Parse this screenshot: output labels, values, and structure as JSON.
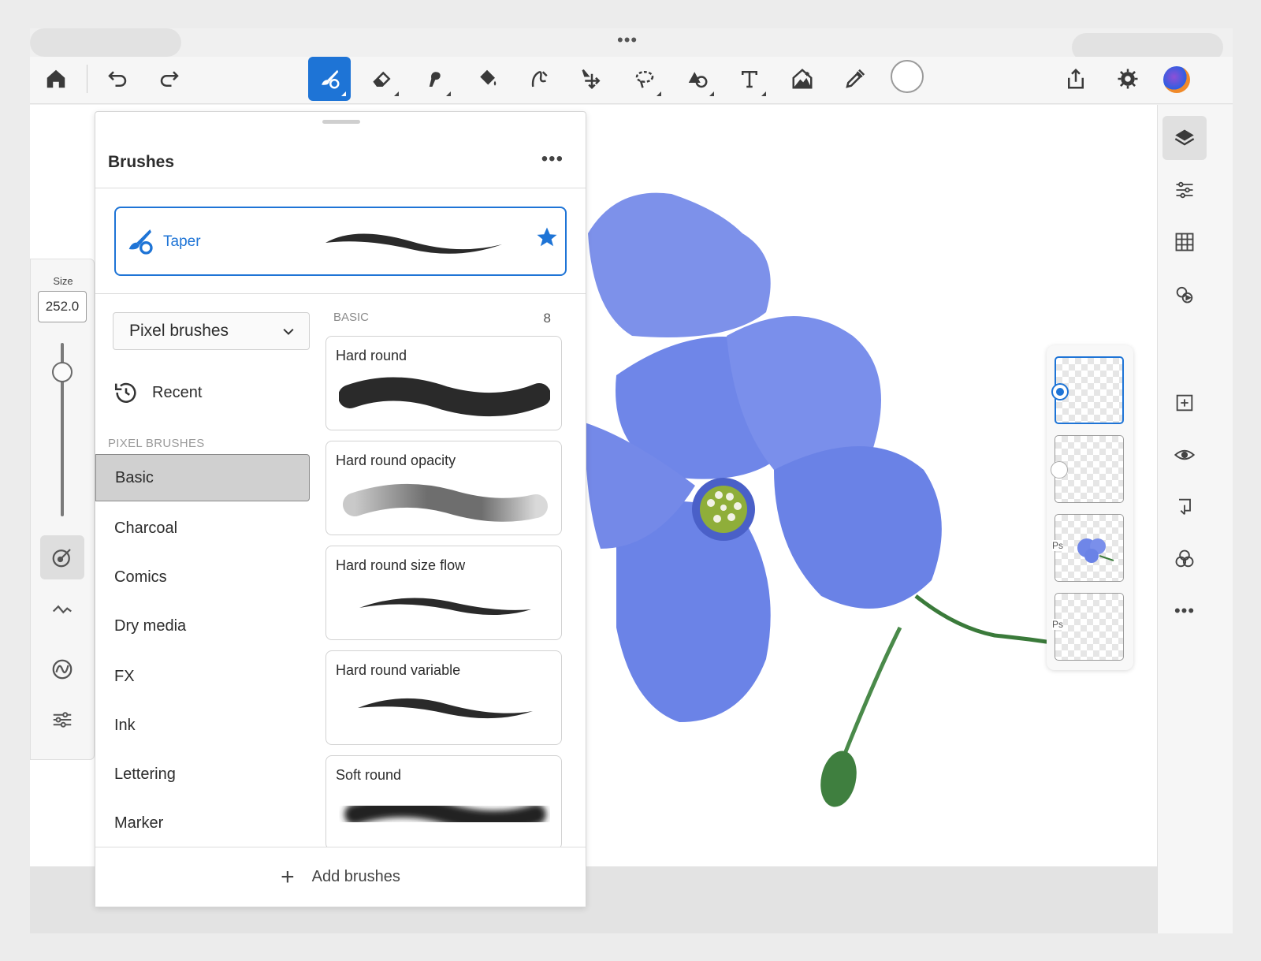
{
  "size_panel": {
    "label": "Size",
    "value": "252.0",
    "slider_level": 0.17
  },
  "brushes_panel": {
    "title": "Brushes",
    "current_brush": "Taper",
    "brush_set": "Pixel brushes",
    "recent_label": "Recent",
    "section_label": "PIXEL BRUSHES",
    "categories": [
      "Basic",
      "Charcoal",
      "Comics",
      "Dry media",
      "FX",
      "Ink",
      "Lettering",
      "Marker"
    ],
    "selected_category": "Basic",
    "list_header": "BASIC",
    "list_count": "8",
    "brushes": [
      "Hard round",
      "Hard round opacity",
      "Hard round size flow",
      "Hard round variable",
      "Soft round"
    ],
    "add_label": "Add brushes"
  },
  "layers_panel": {
    "layers": [
      "",
      "",
      "Ps",
      "Ps"
    ]
  },
  "toolbar": {
    "tools": [
      "home-icon",
      "undo-icon",
      "redo-icon",
      "brush-icon",
      "eraser-icon",
      "smudge-icon",
      "fill-icon",
      "liquify-icon",
      "move-icon",
      "selection-icon",
      "shapes-icon",
      "text-icon",
      "place-image-icon",
      "eyedropper-icon"
    ],
    "active_tool": "brush-icon",
    "current_color": "#ffffff"
  },
  "colors": {
    "accent": "#1e74d6",
    "flower": "#6f86e8",
    "selected_category_bg": "#d0d0d0"
  }
}
